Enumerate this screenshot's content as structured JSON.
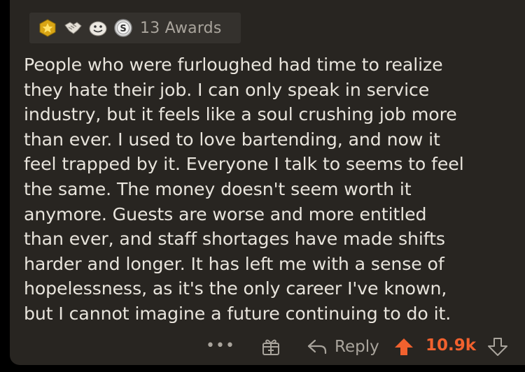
{
  "awards": {
    "icons": [
      "gold-star-award-icon",
      "handshake-award-icon",
      "face-award-icon",
      "silver-s-award-icon"
    ],
    "count_label": "13 Awards"
  },
  "comment": {
    "lines": [
      "People who were furloughed had time to realize",
      "they hate their job. I can only speak in service",
      "industry, but it feels like a soul crushing job more",
      "than ever. I used to love bartending, and now it",
      "feel trapped by it. Everyone I talk to seems to feel",
      "the same. The money doesn't seem worth it",
      "anymore. Guests are worse and more entitled",
      "than ever, and staff shortages have made shifts",
      "harder and longer. It has left me with a sense of",
      "hopelessness, as it's the only career I've known,",
      "but I cannot imagine a future continuing to do it."
    ]
  },
  "actions": {
    "more_label": "•••",
    "reply_label": "Reply",
    "score": "10.9k"
  },
  "colors": {
    "card_bg": "#282521",
    "text": "#e8e4dc",
    "muted": "#a9a49c",
    "upvote_accent": "#f1612e"
  }
}
